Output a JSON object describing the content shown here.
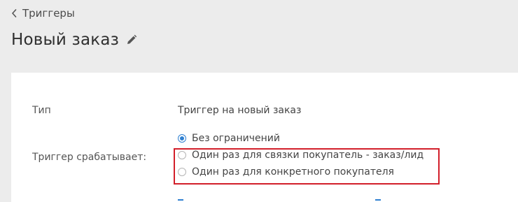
{
  "header": {
    "back_link_label": "Триггеры",
    "title": "Новый заказ"
  },
  "card": {
    "type_label": "Тип",
    "type_value": "Триггер на новый заказ",
    "trigger_label": "Триггер срабатывает:",
    "options": [
      {
        "label": "Без ограничений",
        "selected": true
      },
      {
        "label": "Один раз для связки покупатель - заказ/лид",
        "selected": false
      },
      {
        "label": "Один раз для конкретного покупателя",
        "selected": false
      }
    ]
  },
  "colors": {
    "accent": "#2f80d1",
    "highlight": "#d21f2a",
    "background": "#ececec",
    "card": "#ffffff"
  },
  "icons": {
    "back": "chevron-left-icon",
    "edit": "pencil-icon"
  }
}
